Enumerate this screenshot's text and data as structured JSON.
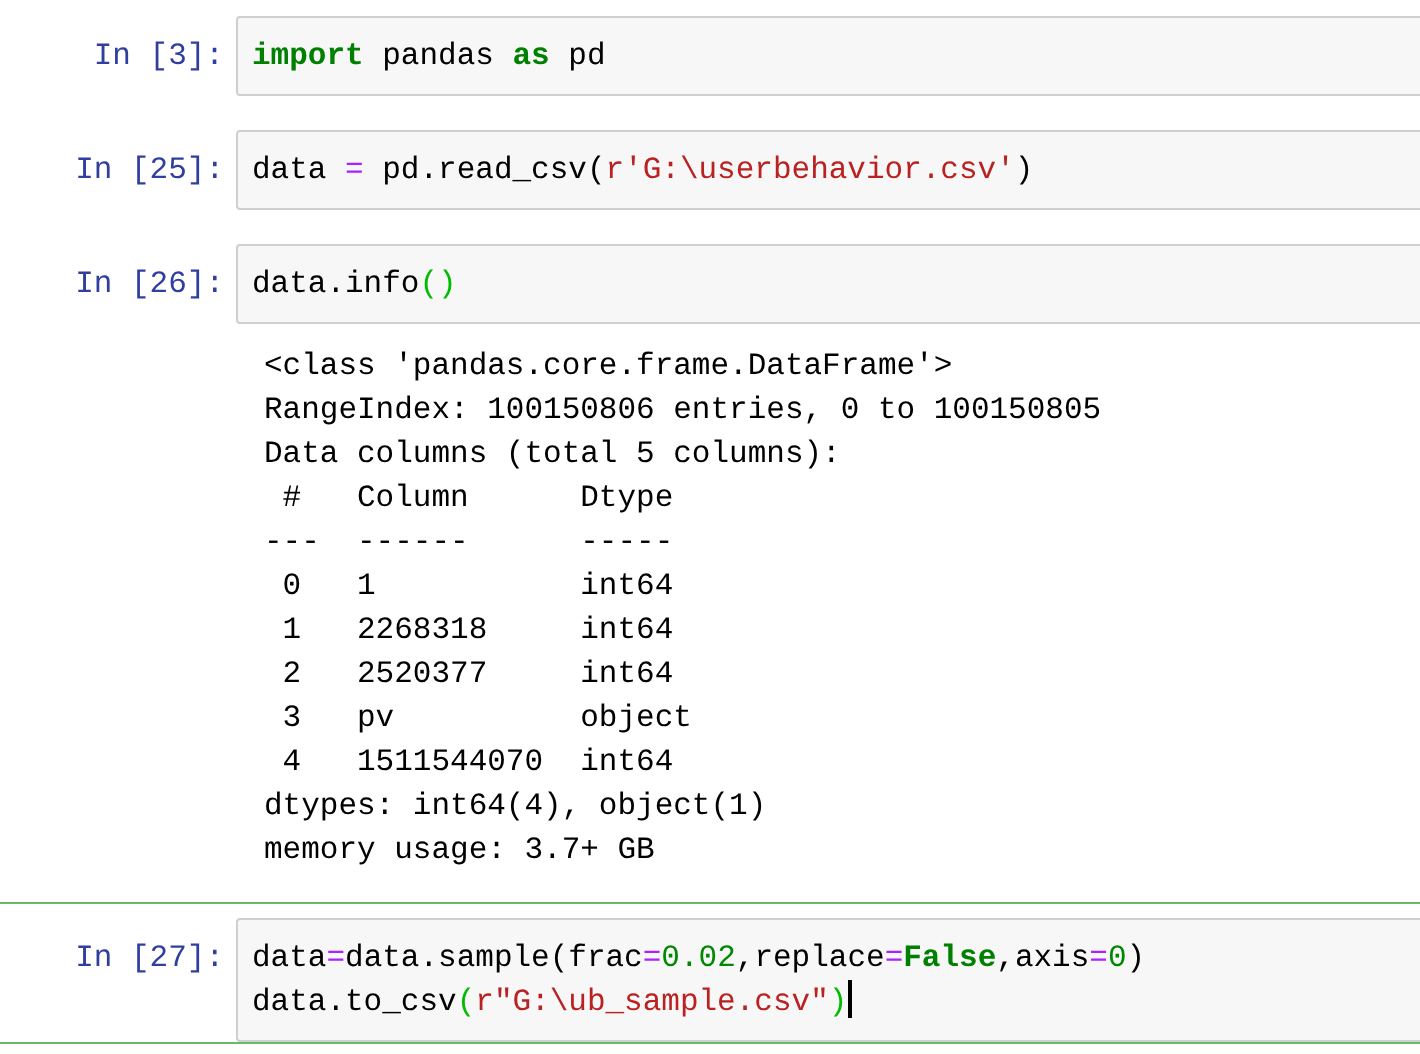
{
  "cells": [
    {
      "prompt": "In [3]:",
      "selected": false,
      "code": [
        [
          {
            "text": "import",
            "kind": "keyword"
          },
          {
            "text": " pandas ",
            "kind": "plain"
          },
          {
            "text": "as",
            "kind": "keyword"
          },
          {
            "text": " pd",
            "kind": "plain"
          }
        ]
      ]
    },
    {
      "prompt": "In [25]:",
      "selected": false,
      "code": [
        [
          {
            "text": "data ",
            "kind": "plain"
          },
          {
            "text": "=",
            "kind": "operator"
          },
          {
            "text": " pd.read_csv(",
            "kind": "plain"
          },
          {
            "text": "r'G:\\userbehavior.csv'",
            "kind": "string"
          },
          {
            "text": ")",
            "kind": "plain"
          }
        ]
      ]
    },
    {
      "prompt": "In [26]:",
      "selected": false,
      "code": [
        [
          {
            "text": "data.info",
            "kind": "plain"
          },
          {
            "text": "()",
            "kind": "bracket"
          }
        ]
      ],
      "output": [
        "<class 'pandas.core.frame.DataFrame'>",
        "RangeIndex: 100150806 entries, 0 to 100150805",
        "Data columns (total 5 columns):",
        " #   Column      Dtype",
        "---  ------      -----",
        " 0   1           int64",
        " 1   2268318     int64",
        " 2   2520377     int64",
        " 3   pv          object",
        " 4   1511544070  int64",
        "dtypes: int64(4), object(1)",
        "memory usage: 3.7+ GB"
      ]
    },
    {
      "prompt": "In [27]:",
      "selected": true,
      "code": [
        [
          {
            "text": "data",
            "kind": "plain"
          },
          {
            "text": "=",
            "kind": "operator"
          },
          {
            "text": "data.sample(frac",
            "kind": "plain"
          },
          {
            "text": "=",
            "kind": "operator"
          },
          {
            "text": "0.02",
            "kind": "number"
          },
          {
            "text": ",replace",
            "kind": "plain"
          },
          {
            "text": "=",
            "kind": "operator"
          },
          {
            "text": "False",
            "kind": "keyword"
          },
          {
            "text": ",axis",
            "kind": "plain"
          },
          {
            "text": "=",
            "kind": "operator"
          },
          {
            "text": "0",
            "kind": "number"
          },
          {
            "text": ")",
            "kind": "plain"
          }
        ],
        [
          {
            "text": "data.to_csv",
            "kind": "plain"
          },
          {
            "text": "(",
            "kind": "bracket"
          },
          {
            "text": "r\"G:\\ub_sample.csv\"",
            "kind": "string"
          },
          {
            "text": ")",
            "kind": "bracket"
          }
        ]
      ]
    }
  ]
}
